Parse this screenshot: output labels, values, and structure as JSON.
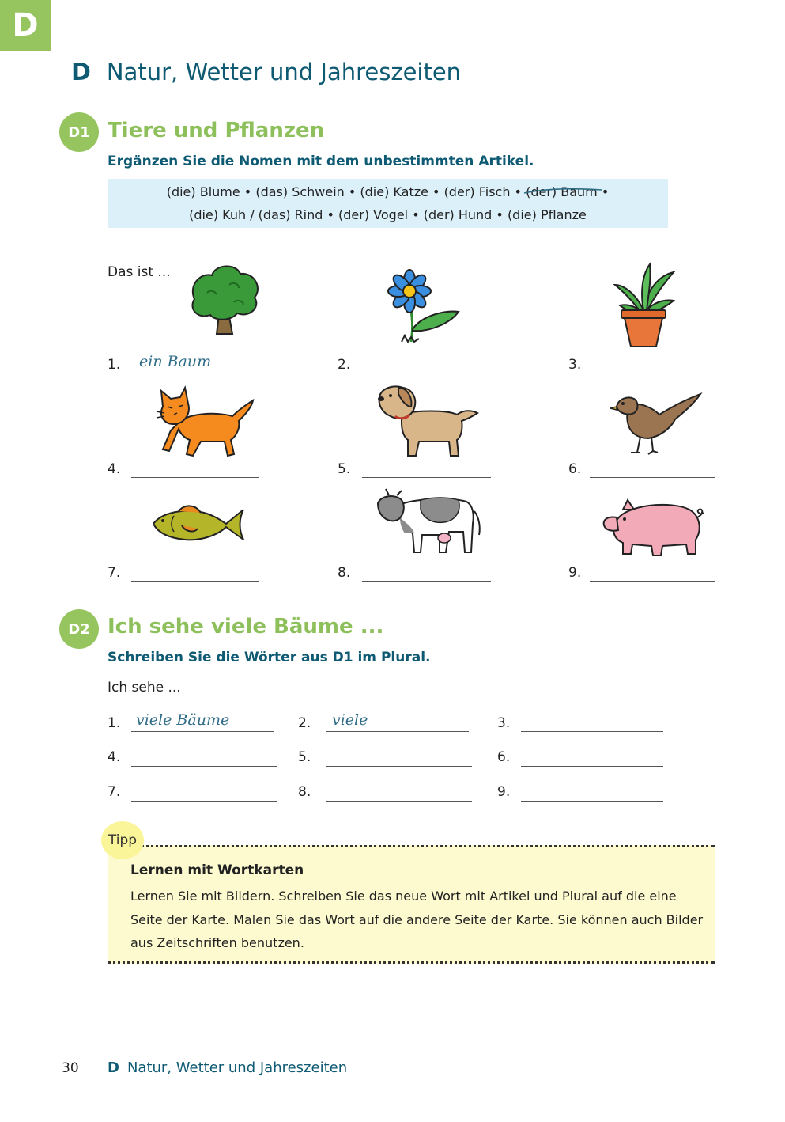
{
  "chapter": {
    "letter": "D",
    "title": "Natur, Wetter und Jahreszeiten"
  },
  "d1": {
    "badge": "D1",
    "title": "Tiere und Pflanzen",
    "instruction": "Ergänzen Sie die Nomen mit dem unbestimmten Artikel.",
    "wordbox_line1_a": "(die) Blume • (das) Schwein • (die) Katze • (der) Fisch •",
    "wordbox_line1_struck": "(der) Baum",
    "wordbox_line1_b": "•",
    "wordbox_line2": "(die) Kuh / (das) Rind • (der) Vogel • (der) Hund • (die) Pflanze",
    "lead": "Das ist ...",
    "items": [
      {
        "num": "1.",
        "answer": "ein Baum",
        "picture": "tree-picture"
      },
      {
        "num": "2.",
        "answer": "",
        "picture": "flower-picture"
      },
      {
        "num": "3.",
        "answer": "",
        "picture": "potted-plant-picture"
      },
      {
        "num": "4.",
        "answer": "",
        "picture": "cat-picture"
      },
      {
        "num": "5.",
        "answer": "",
        "picture": "dog-picture"
      },
      {
        "num": "6.",
        "answer": "",
        "picture": "bird-picture"
      },
      {
        "num": "7.",
        "answer": "",
        "picture": "fish-picture"
      },
      {
        "num": "8.",
        "answer": "",
        "picture": "cow-picture"
      },
      {
        "num": "9.",
        "answer": "",
        "picture": "pig-picture"
      }
    ]
  },
  "d2": {
    "badge": "D2",
    "title": "Ich sehe viele Bäume ...",
    "instruction": "Schreiben Sie die Wörter aus D1 im Plural.",
    "lead": "Ich sehe ...",
    "items": [
      {
        "num": "1.",
        "answer": "viele Bäume"
      },
      {
        "num": "2.",
        "answer": "viele"
      },
      {
        "num": "3.",
        "answer": ""
      },
      {
        "num": "4.",
        "answer": ""
      },
      {
        "num": "5.",
        "answer": ""
      },
      {
        "num": "6.",
        "answer": ""
      },
      {
        "num": "7.",
        "answer": ""
      },
      {
        "num": "8.",
        "answer": ""
      },
      {
        "num": "9.",
        "answer": ""
      }
    ]
  },
  "tipp": {
    "badge": "Tipp",
    "title": "Lernen mit Wortkarten",
    "text": "Lernen Sie mit Bildern. Schreiben Sie das neue Wort mit Artikel und Plural auf die eine Seite der Karte. Malen Sie das Wort auf die andere Seite der Karte. Sie können auch Bilder aus Zeitschriften benutzen."
  },
  "footer": {
    "page_number": "30",
    "letter": "D",
    "title": "Natur, Wetter und Jahreszeiten"
  },
  "colors": {
    "green": "#96c560",
    "teal": "#0e5a73",
    "wordbox": "#dcf0fa",
    "tipp": "#fdfad0",
    "handwriting": "#2f6d87"
  }
}
